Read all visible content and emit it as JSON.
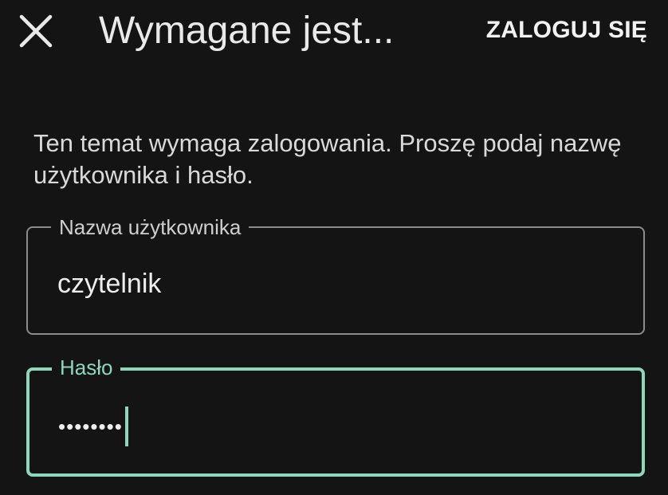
{
  "header": {
    "close_icon": "close-icon",
    "title": "Wymagane jest...",
    "login_label": "ZALOGUJ SIĘ"
  },
  "message": "Ten temat wymaga zalogowania. Proszę podaj nazwę użytkownika i hasło.",
  "username_field": {
    "label": "Nazwa użytkownika",
    "value": "czytelnik"
  },
  "password_field": {
    "label": "Hasło",
    "masked_value": "••••••••"
  },
  "colors": {
    "background": "#141414",
    "accent": "#8fd6bb",
    "text": "#e9e9e9",
    "outline": "#8c8c8c"
  }
}
